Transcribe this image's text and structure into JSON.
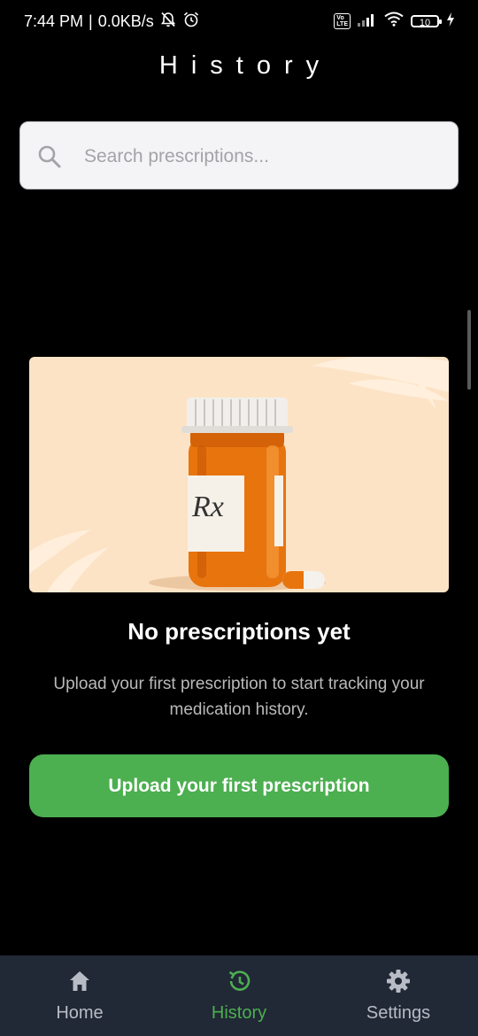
{
  "status_bar": {
    "time": "7:44 PM",
    "separator": "|",
    "speed": "0.0KB/s",
    "volte_top": "Vo",
    "volte_bottom": "LTE",
    "battery": "10"
  },
  "header": {
    "title": "History"
  },
  "search": {
    "placeholder": "Search prescriptions...",
    "value": ""
  },
  "empty_state": {
    "title": "No prescriptions yet",
    "description": "Upload your first prescription to start tracking your medication history.",
    "illustration_label": "Rx",
    "button_label": "Upload your first prescription"
  },
  "bottom_nav": {
    "items": [
      {
        "label": "Home",
        "icon": "home-icon",
        "active": false
      },
      {
        "label": "History",
        "icon": "history-icon",
        "active": true
      },
      {
        "label": "Settings",
        "icon": "gear-icon",
        "active": false
      }
    ]
  },
  "colors": {
    "background": "#000000",
    "accent": "#4caf50",
    "nav_background": "#212836",
    "illustration_background": "#fce3c6",
    "bottle": "#e8740e"
  }
}
